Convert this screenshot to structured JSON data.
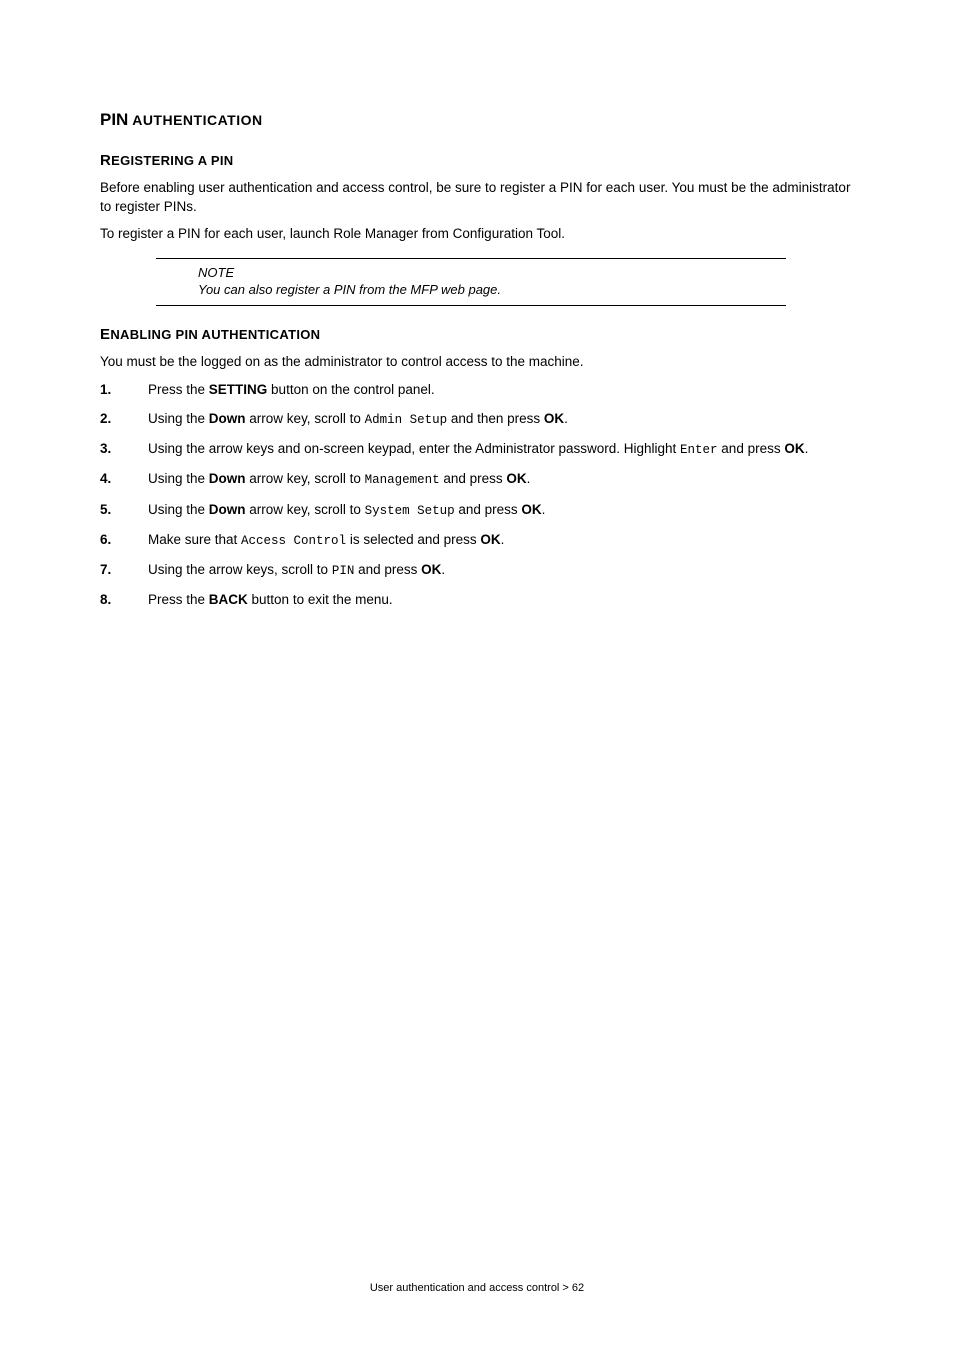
{
  "section": {
    "title_strong": "PIN",
    "title_rest": " AUTHENTICATION"
  },
  "sub1": {
    "heading_first": "R",
    "heading_rest": "EGISTERING A ",
    "heading_strong": "PIN",
    "p1": "Before enabling user authentication and access control, be sure to register a PIN for each user. You must be the administrator to register PINs.",
    "p2": "To register a PIN for each user, launch Role Manager from Configuration Tool."
  },
  "note": {
    "label": "NOTE",
    "text": "You can also register a PIN from the MFP web page."
  },
  "sub2": {
    "heading_first": "E",
    "heading_rest": "NABLING ",
    "heading_strong": "PIN",
    "heading_tail": " AUTHENTICATION",
    "intro": "You must be the logged on as the administrator to control access to the machine."
  },
  "steps": {
    "s1": {
      "num": "1.",
      "a": "Press the ",
      "b": "SETTING",
      "c": " button on the control panel."
    },
    "s2": {
      "num": "2.",
      "a": "Using the ",
      "b": "Down",
      "c": " arrow key, scroll to ",
      "m": "Admin Setup",
      "d": " and then press ",
      "e": "OK",
      "f": "."
    },
    "s3": {
      "num": "3.",
      "a": "Using the arrow keys and on-screen keypad, enter the Administrator password. Highlight ",
      "m": "Enter",
      "b": " and press ",
      "c": "OK",
      "d": "."
    },
    "s4": {
      "num": "4.",
      "a": "Using the ",
      "b": "Down",
      "c": " arrow key, scroll to ",
      "m": "Management",
      "d": " and press ",
      "e": "OK",
      "f": "."
    },
    "s5": {
      "num": "5.",
      "a": "Using the ",
      "b": "Down",
      "c": " arrow key, scroll to ",
      "m": "System Setup",
      "d": " and press ",
      "e": "OK",
      "f": "."
    },
    "s6": {
      "num": "6.",
      "a": "Make sure that ",
      "m": "Access Control",
      "b": " is selected and press ",
      "c": "OK",
      "d": "."
    },
    "s7": {
      "num": "7.",
      "a": "Using the arrow keys, scroll to ",
      "m": "PIN",
      "b": " and press ",
      "c": "OK",
      "d": "."
    },
    "s8": {
      "num": "8.",
      "a": "Press the ",
      "b": "BACK",
      "c": " button to exit the menu."
    }
  },
  "footer": "User authentication and access control > 62"
}
